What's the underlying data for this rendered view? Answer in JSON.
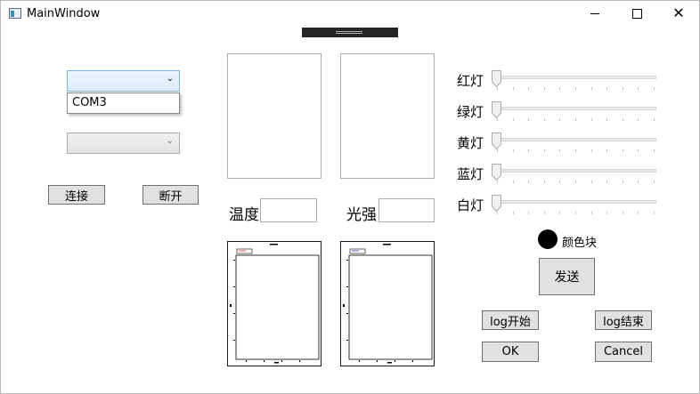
{
  "window": {
    "title": "MainWindow"
  },
  "serial": {
    "port_combo_value": "",
    "port_options": [
      "COM3"
    ],
    "baud_combo_value": "",
    "connect_label": "连接",
    "disconnect_label": "断开"
  },
  "sensors": {
    "temperature_label": "温度",
    "temperature_value": "",
    "light_label": "光强",
    "light_value": ""
  },
  "lights": [
    {
      "label": "红灯",
      "value": 0
    },
    {
      "label": "绿灯",
      "value": 0
    },
    {
      "label": "黄灯",
      "value": 0
    },
    {
      "label": "蓝灯",
      "value": 0
    },
    {
      "label": "白灯",
      "value": 0
    }
  ],
  "color_block": {
    "label": "颜色块",
    "color": "#000000"
  },
  "actions": {
    "send_label": "发送",
    "log_start_label": "log开始",
    "log_end_label": "log结束",
    "ok_label": "OK",
    "cancel_label": "Cancel"
  }
}
